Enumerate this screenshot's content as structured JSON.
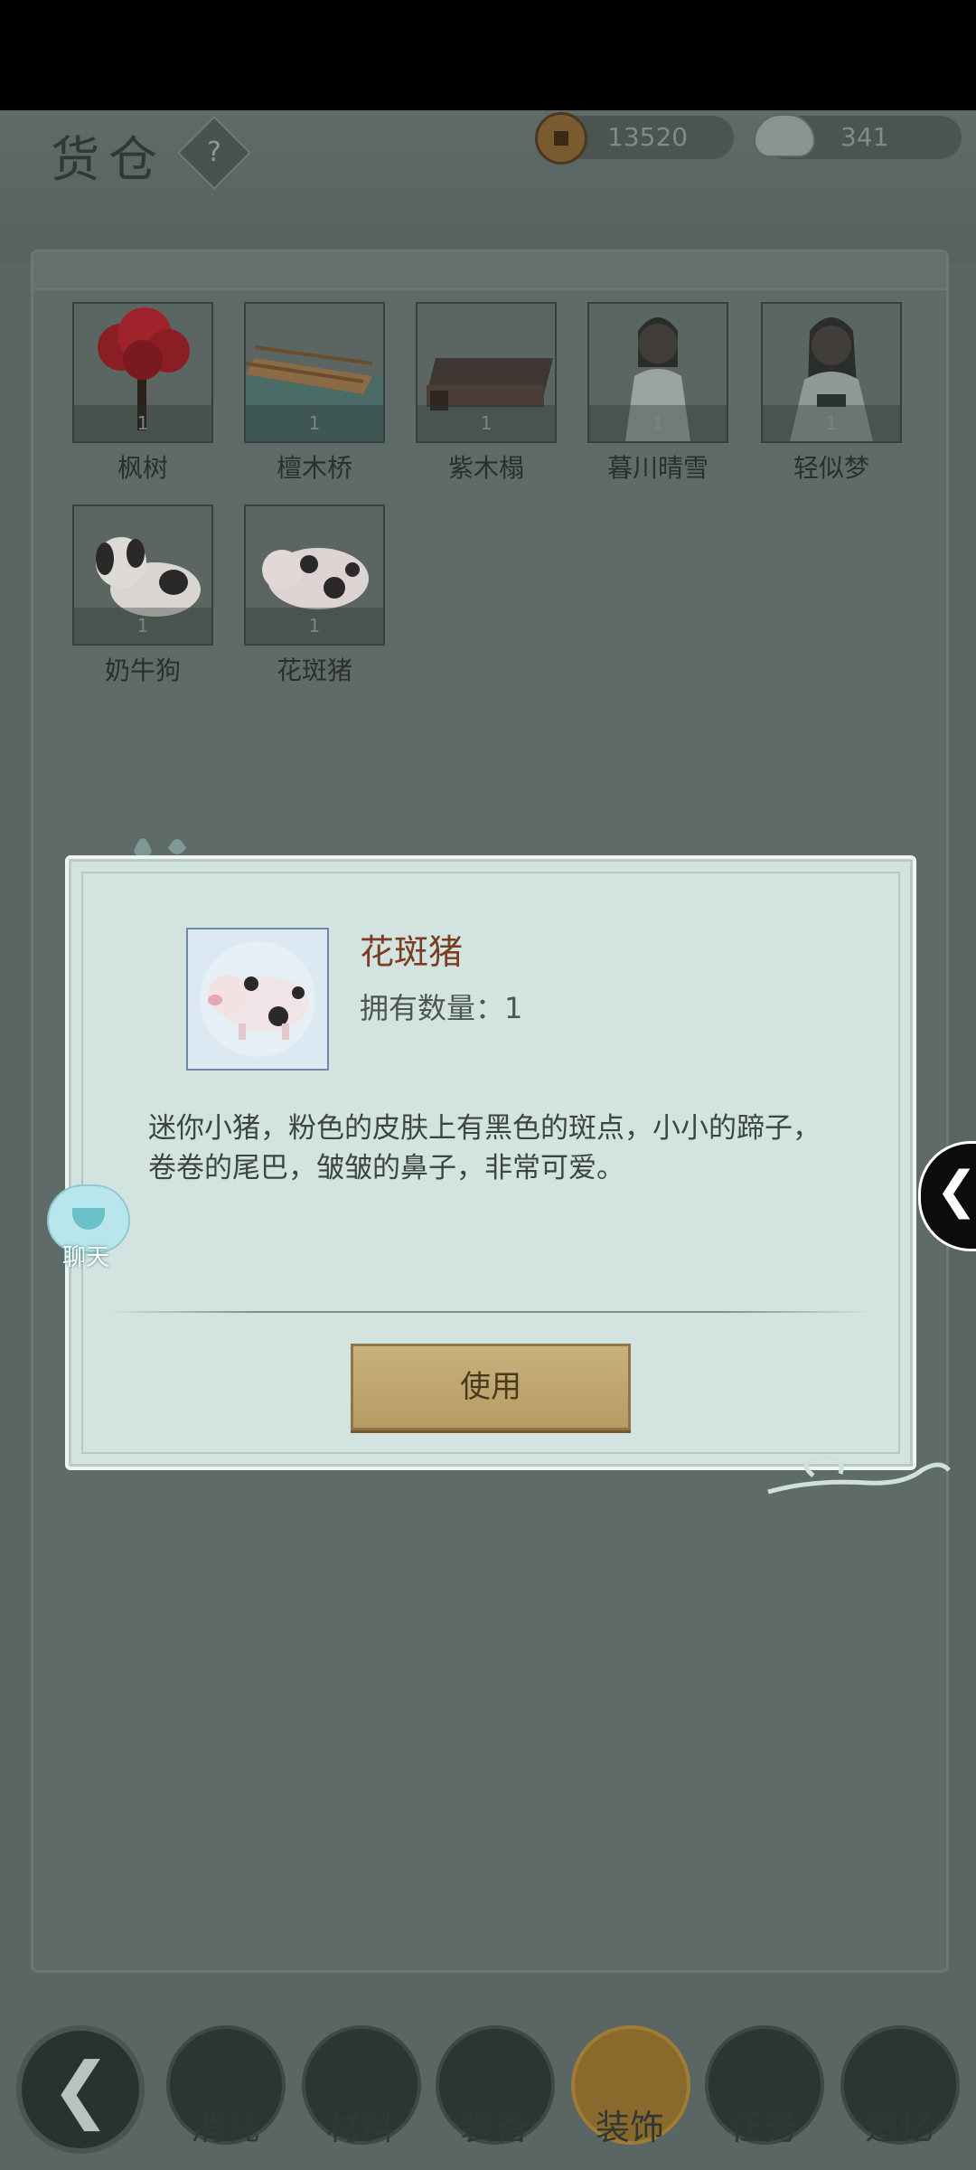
{
  "header": {
    "title": "货仓",
    "help_label": "?",
    "coins": "13520",
    "silver": "341"
  },
  "items": [
    {
      "name": "枫树",
      "qty": "1"
    },
    {
      "name": "檀木桥",
      "qty": "1"
    },
    {
      "name": "紫木榻",
      "qty": "1"
    },
    {
      "name": "暮川晴雪",
      "qty": "1"
    },
    {
      "name": "轻似梦",
      "qty": "1"
    },
    {
      "name": "奶牛狗",
      "qty": "1"
    },
    {
      "name": "花斑猪",
      "qty": "1"
    }
  ],
  "dialog": {
    "name": "花斑猪",
    "count_label": "拥有数量：1",
    "description": "迷你小猪，粉色的皮肤上有黑色的斑点，小小的蹄子，卷卷的尾巴，皱皱的鼻子，非常可爱。",
    "use_label": "使用"
  },
  "chat": {
    "label": "聊天"
  },
  "nav": {
    "back_symbol": "❮",
    "tabs": [
      {
        "label": "消耗",
        "active": false
      },
      {
        "label": "材料",
        "active": false
      },
      {
        "label": "装备",
        "active": false
      },
      {
        "label": "装饰",
        "active": true
      },
      {
        "label": "任务",
        "active": false
      },
      {
        "label": "追忆",
        "active": false
      }
    ]
  },
  "side_tab": {
    "symbol": "❮"
  }
}
